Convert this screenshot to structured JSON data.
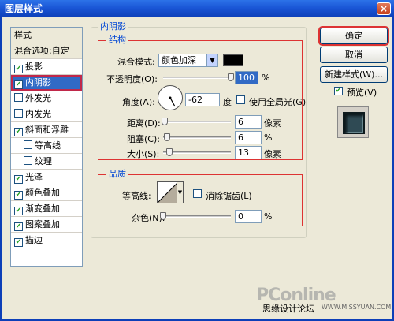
{
  "window": {
    "title": "图层样式",
    "close_label": "×"
  },
  "styles_list": {
    "header": "样式",
    "blend_options": "混合选项:自定",
    "items": [
      {
        "label": "投影",
        "checked": true
      },
      {
        "label": "内阴影",
        "checked": true,
        "selected": true
      },
      {
        "label": "外发光",
        "checked": false
      },
      {
        "label": "内发光",
        "checked": false
      },
      {
        "label": "斜面和浮雕",
        "checked": true
      },
      {
        "label": "等高线",
        "checked": false,
        "indent": true
      },
      {
        "label": "纹理",
        "checked": false,
        "indent": true
      },
      {
        "label": "光泽",
        "checked": true
      },
      {
        "label": "颜色叠加",
        "checked": true
      },
      {
        "label": "渐变叠加",
        "checked": true
      },
      {
        "label": "图案叠加",
        "checked": true
      },
      {
        "label": "描边",
        "checked": true
      }
    ]
  },
  "inner_shadow": {
    "legend": "内阴影",
    "structure": {
      "legend": "结构",
      "blend_mode_label": "混合模式:",
      "blend_mode_value": "颜色加深",
      "shadow_color": "#000000",
      "opacity_label": "不透明度(O):",
      "opacity_value": "100",
      "opacity_unit": "%",
      "angle_label": "角度(A):",
      "angle_value": "-62",
      "angle_unit": "度",
      "global_light_label": "使用全局光(G)",
      "distance_label": "距离(D):",
      "distance_value": "6",
      "distance_unit": "像素",
      "choke_label": "阻塞(C):",
      "choke_value": "6",
      "choke_unit": "%",
      "size_label": "大小(S):",
      "size_value": "13",
      "size_unit": "像素"
    },
    "quality": {
      "legend": "品质",
      "contour_label": "等高线:",
      "anti_alias_label": "消除锯齿(L)",
      "noise_label": "杂色(N):",
      "noise_value": "0",
      "noise_unit": "%"
    }
  },
  "buttons": {
    "ok": "确定",
    "cancel": "取消",
    "new_style": "新建样式(W)...",
    "preview_label": "预览(V)"
  },
  "watermark": "PConline",
  "credit": "思缘设计论坛",
  "credit_url": "WWW.MISSYUAN.COM"
}
